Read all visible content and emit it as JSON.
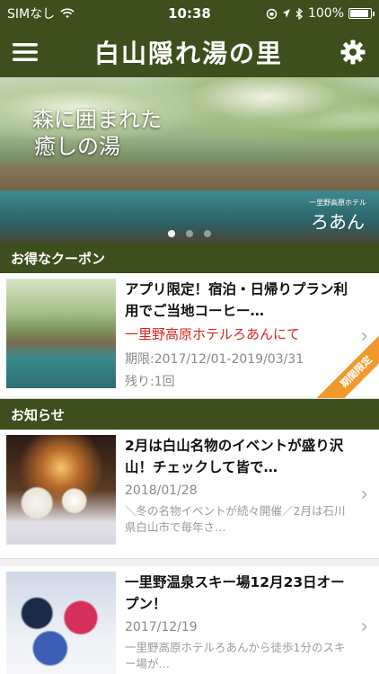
{
  "status_bar": {
    "carrier": "SIMなし",
    "time": "10:38",
    "battery": "100%",
    "wifi_icon": "wifi-icon",
    "battery_level": 1.0
  },
  "navbar": {
    "title": "白山隠れ湯の里",
    "menu_icon": "hamburger-menu-icon",
    "settings_icon": "gear-icon"
  },
  "hero": {
    "tagline_line1": "森に囲まれた",
    "tagline_line2": "癒しの湯",
    "logo_small": "一里野高原ホテル",
    "logo_big": "ろあん",
    "slide_count": 3,
    "active_slide": 1
  },
  "coupon_section": {
    "header": "お得なクーポン",
    "coupon": {
      "title": "アプリ限定！宿泊・日帰りプラン利用でご当地コーヒー…",
      "place": "一里野高原ホテルろあんにて",
      "period": "期限:2017/12/01-2019/03/31",
      "remaining": "残り:1回",
      "ribbon": "期間限定"
    }
  },
  "news_section": {
    "header": "お知らせ",
    "items": [
      {
        "title": "2月は白山名物のイベントが盛り沢山！チェックして皆で…",
        "date": "2018/01/28",
        "desc": "＼冬の名物イベントが続々開催／2月は石川県白山市で毎年さ…"
      },
      {
        "title": "一里野温泉スキー場12月23日オープン！",
        "date": "2017/12/19",
        "desc": "一里野高原ホテルろあんから徒歩1分のスキー場が…"
      }
    ]
  },
  "colors": {
    "brand_green": "#3d4f1c",
    "accent_red": "#d9251c",
    "ribbon_orange": "#f19a2b"
  }
}
